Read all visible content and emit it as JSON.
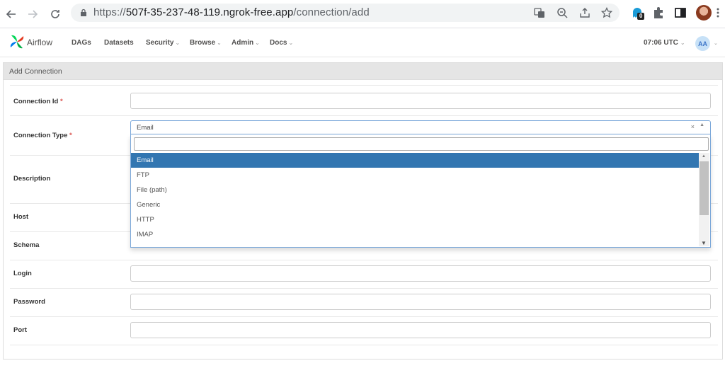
{
  "browser": {
    "url_prefix": "https://",
    "url_host": "507f-35-237-48-119.ngrok-free.app",
    "url_path": "/connection/add",
    "extension_badge": "0"
  },
  "navbar": {
    "brand": "Airflow",
    "items": [
      {
        "label": "DAGs",
        "caret": false
      },
      {
        "label": "Datasets",
        "caret": false
      },
      {
        "label": "Security",
        "caret": true
      },
      {
        "label": "Browse",
        "caret": true
      },
      {
        "label": "Admin",
        "caret": true
      },
      {
        "label": "Docs",
        "caret": true
      }
    ],
    "time": "07:06 UTC",
    "avatar": "AA"
  },
  "panel": {
    "title": "Add Connection"
  },
  "form": {
    "connection_id_label": "Connection Id",
    "connection_type_label": "Connection Type",
    "required_mark": "*",
    "description_label": "Description",
    "host_label": "Host",
    "schema_label": "Schema",
    "login_label": "Login",
    "password_label": "Password",
    "port_label": "Port",
    "connection_type_value": "Email",
    "clear_symbol": "×"
  },
  "dropdown": {
    "options": [
      "Email",
      "FTP",
      "File (path)",
      "Generic",
      "HTTP",
      "IMAP"
    ],
    "selected": "Email"
  }
}
